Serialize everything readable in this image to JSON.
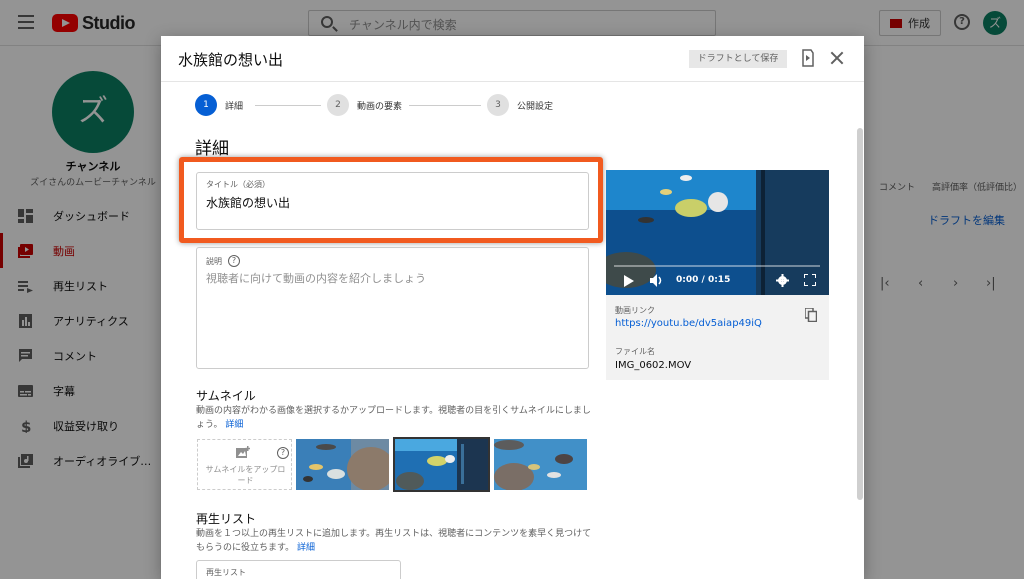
{
  "topbar": {
    "logo_text": "Studio",
    "search_placeholder": "チャンネル内で検索",
    "create_label": "作成",
    "avatar_letter": "ズ"
  },
  "sidebar": {
    "avatar_letter": "ズ",
    "channel_title": "チャンネル",
    "channel_sub": "ズイさんのムービーチャンネル",
    "items": [
      {
        "label": "ダッシュボード",
        "icon": "dashboard-icon"
      },
      {
        "label": "動画",
        "icon": "video-icon",
        "active": true
      },
      {
        "label": "再生リスト",
        "icon": "playlist-icon"
      },
      {
        "label": "アナリティクス",
        "icon": "analytics-icon"
      },
      {
        "label": "コメント",
        "icon": "comment-icon"
      },
      {
        "label": "字幕",
        "icon": "subtitles-icon"
      },
      {
        "label": "収益受け取り",
        "icon": "dollar-icon"
      },
      {
        "label": "オーディオライブ…",
        "icon": "audio-library-icon"
      }
    ]
  },
  "background": {
    "col_comments": "コメント",
    "col_rating": "高評価率（低評価比）",
    "edit_draft_link": "ドラフトを編集"
  },
  "modal": {
    "title": "水族館の想い出",
    "draft_button": "ドラフトとして保存",
    "steps": [
      {
        "num": "1",
        "label": "詳細",
        "active": true
      },
      {
        "num": "2",
        "label": "動画の要素"
      },
      {
        "num": "3",
        "label": "公開設定"
      }
    ],
    "section_title": "詳細",
    "title_field": {
      "label": "タイトル（必須）",
      "value": "水族館の想い出"
    },
    "description_field": {
      "label": "説明",
      "placeholder": "視聴者に向けて動画の内容を紹介しましょう"
    },
    "thumbnail": {
      "title": "サムネイル",
      "description": "動画の内容がわかる画像を選択するかアップロードします。視聴者の目を引くサムネイルにしましょう。",
      "details_link": "詳細",
      "upload_label": "サムネイルをアップロード",
      "selected_index": 1
    },
    "playlist": {
      "title": "再生リスト",
      "description": "動画を１つ以上の再生リストに追加します。再生リストは、視聴者にコンテンツを素早く見つけてもらうのに役立ちます。",
      "details_link": "詳細",
      "select_label": "再生リスト"
    },
    "video": {
      "time": "0:00 / 0:15",
      "link_label": "動画リンク",
      "link": "https://youtu.be/dv5aiap49iQ",
      "filename_label": "ファイル名",
      "filename": "IMG_0602.MOV"
    }
  },
  "colors": {
    "accent_red": "#cc0000",
    "brand_blue": "#065fd4",
    "avatar_green": "#0b8062",
    "highlight_orange": "#f15a1f"
  }
}
